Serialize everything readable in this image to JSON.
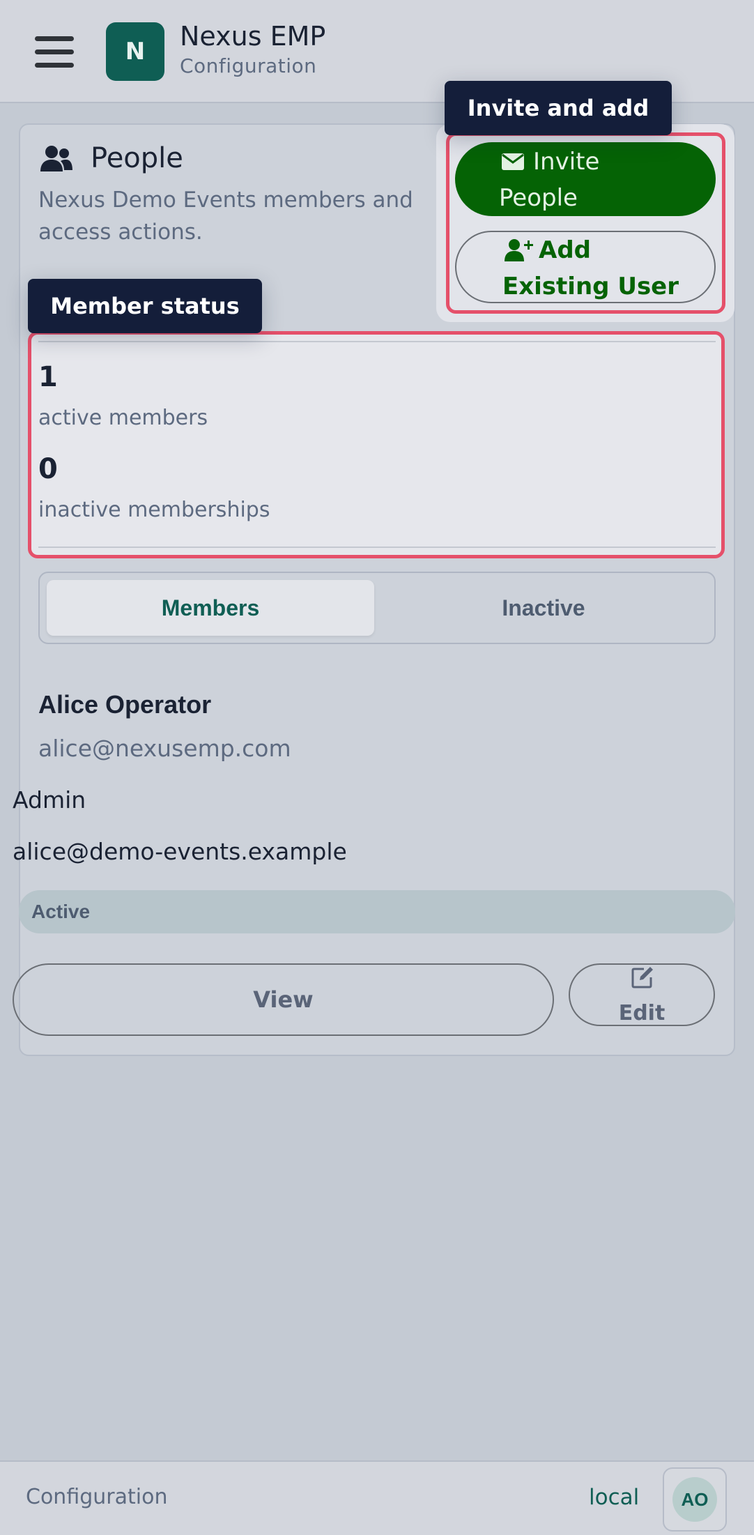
{
  "header": {
    "logo_letter": "N",
    "app_title": "Nexus EMP",
    "app_subtitle": "Configuration"
  },
  "people": {
    "title": "People",
    "description": "Nexus Demo Events members and access actions.",
    "invite_button": {
      "line1": "Invite",
      "line2": "People"
    },
    "add_button": {
      "line1": "Add",
      "line2": "Existing User"
    }
  },
  "tooltips": {
    "invite_and_add": "Invite and add",
    "member_status": "Member status"
  },
  "stats": {
    "active_count": "1",
    "active_label": "active members",
    "inactive_count": "0",
    "inactive_label": "inactive memberships"
  },
  "tabs": {
    "members": "Members",
    "inactive": "Inactive",
    "selected": "Members"
  },
  "member": {
    "name": "Alice Operator",
    "email": "alice@nexusemp.com",
    "role": "Admin",
    "alt_email": "alice@demo-events.example",
    "status": "Active",
    "view_label": "View",
    "edit_label": "Edit"
  },
  "footer": {
    "section": "Configuration",
    "environment": "local",
    "avatar_initials": "AO"
  },
  "colors": {
    "brand": "#0f5e54",
    "primary_button": "#056305",
    "highlight": "#e5506a",
    "tooltip": "#141e3a"
  }
}
